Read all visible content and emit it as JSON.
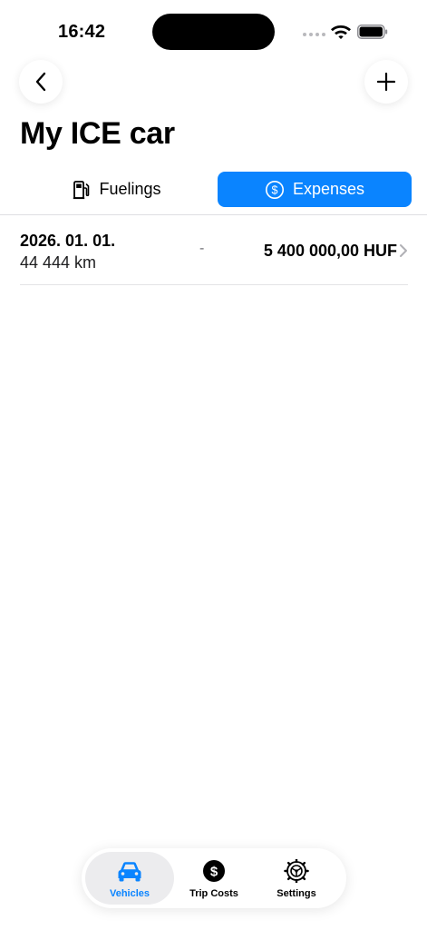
{
  "status_bar": {
    "time": "16:42"
  },
  "page": {
    "title": "My ICE car"
  },
  "tabs": [
    {
      "label": "Fuelings",
      "icon": "fuel-pump-icon",
      "selected": false
    },
    {
      "label": "Expenses",
      "icon": "dollar-circle-icon",
      "selected": true
    }
  ],
  "expenses": [
    {
      "date": "2026. 01. 01.",
      "odometer": "44 444 km",
      "note": "-",
      "amount": "5 400 000,00 HUF"
    }
  ],
  "tabbar": {
    "items": [
      {
        "label": "Vehicles",
        "icon": "car-icon",
        "selected": true
      },
      {
        "label": "Trip Costs",
        "icon": "dollar-coin-icon",
        "selected": false
      },
      {
        "label": "Settings",
        "icon": "gear-icon",
        "selected": false
      }
    ]
  },
  "colors": {
    "accent": "#0a84ff",
    "selected_tab_bg": "#ececee"
  }
}
